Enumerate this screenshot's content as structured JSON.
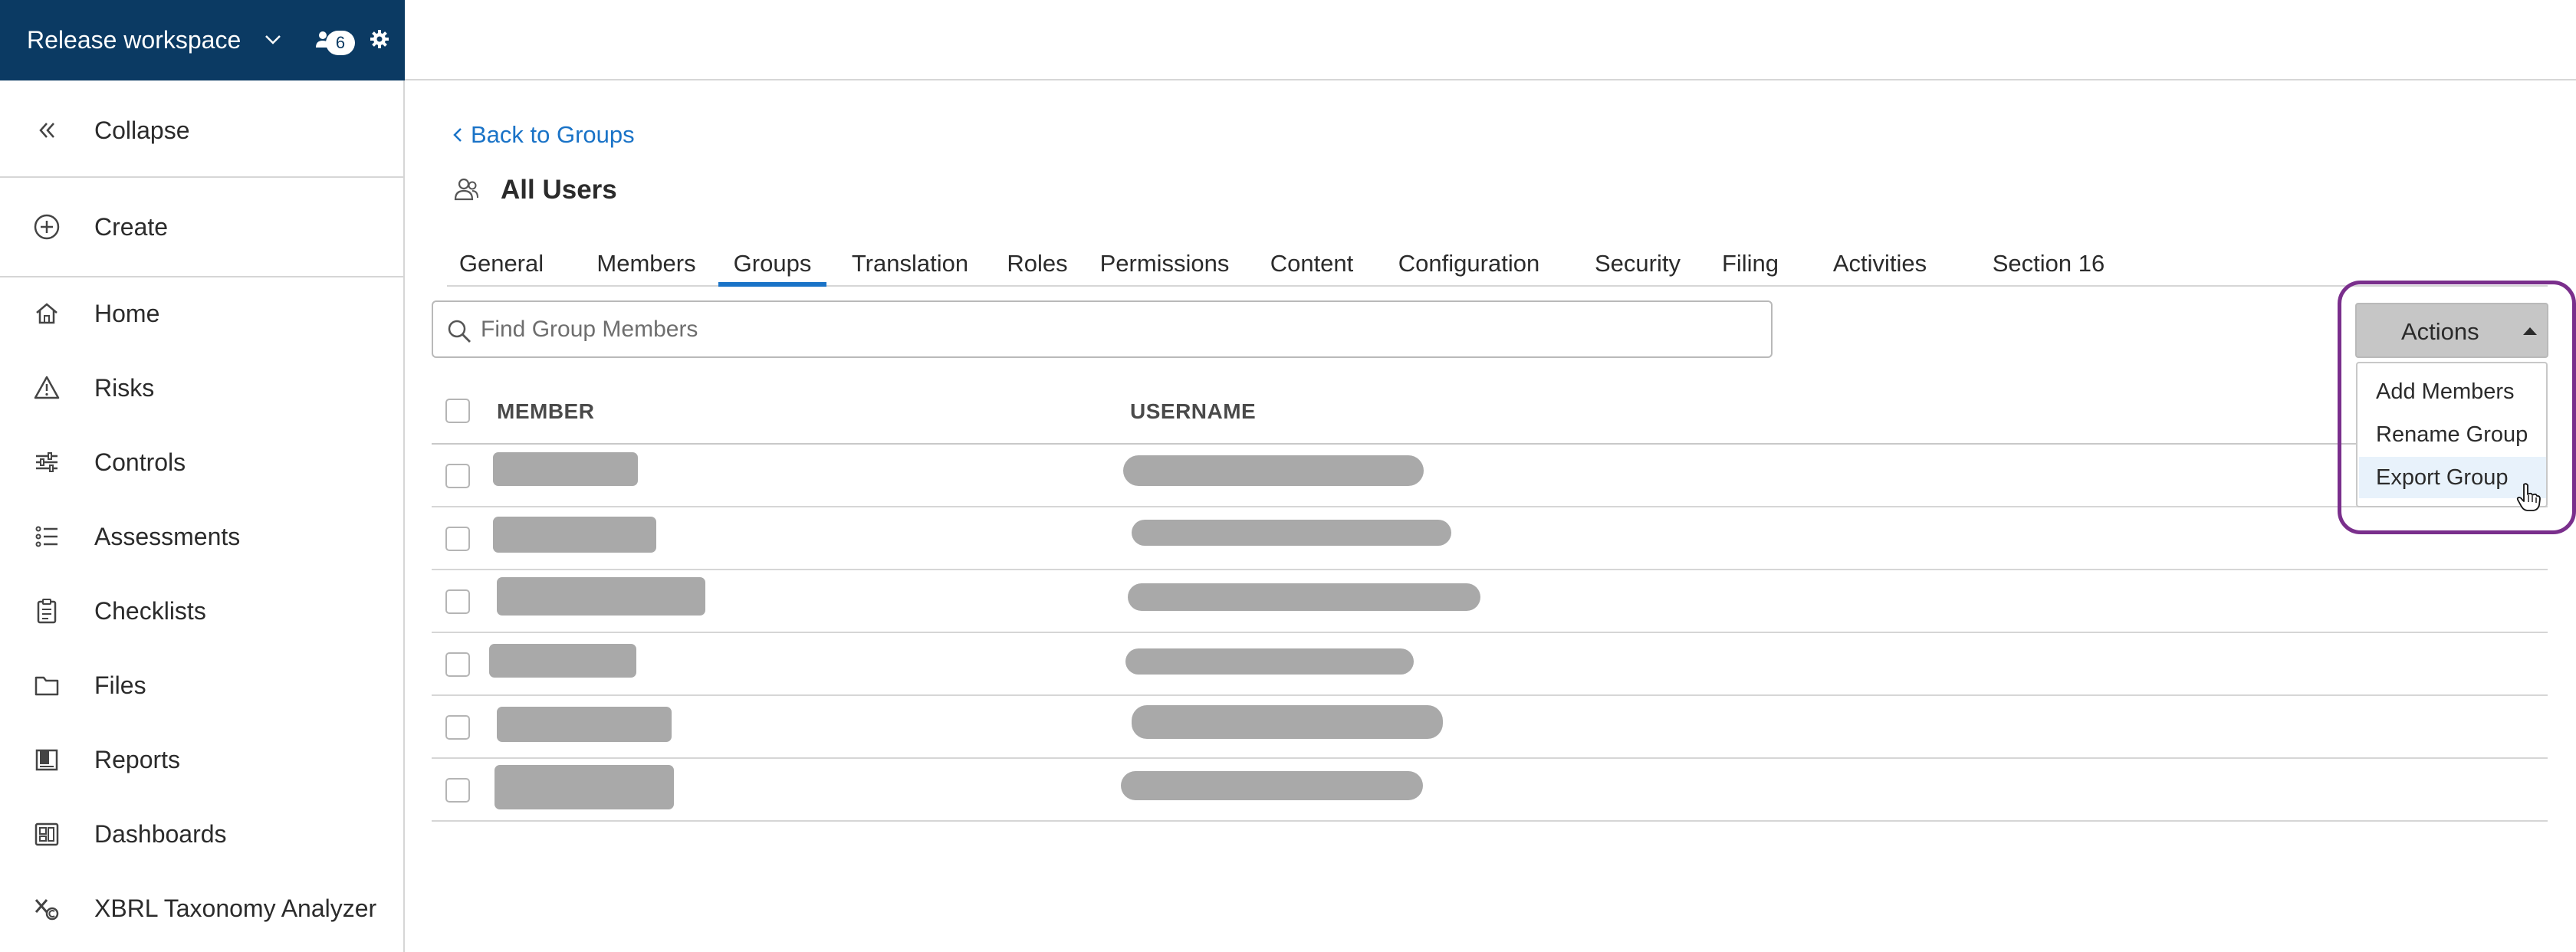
{
  "workspace": {
    "title": "Release workspace",
    "notification_count": "6"
  },
  "sidebar": {
    "collapse_label": "Collapse",
    "create_label": "Create",
    "items": [
      {
        "label": "Home",
        "icon": "home-icon"
      },
      {
        "label": "Risks",
        "icon": "warning-icon"
      },
      {
        "label": "Controls",
        "icon": "sliders-icon"
      },
      {
        "label": "Assessments",
        "icon": "list-icon"
      },
      {
        "label": "Checklists",
        "icon": "clipboard-icon"
      },
      {
        "label": "Files",
        "icon": "folder-icon"
      },
      {
        "label": "Reports",
        "icon": "report-icon"
      },
      {
        "label": "Dashboards",
        "icon": "dashboard-icon"
      },
      {
        "label": "XBRL Taxonomy Analyzer",
        "icon": "xbrl-icon"
      }
    ]
  },
  "main": {
    "back_label": "Back to Groups",
    "title": "All Users",
    "tabs": [
      {
        "label": "General"
      },
      {
        "label": "Members"
      },
      {
        "label": "Groups"
      },
      {
        "label": "Translation"
      },
      {
        "label": "Roles"
      },
      {
        "label": "Permissions"
      },
      {
        "label": "Content"
      },
      {
        "label": "Configuration"
      },
      {
        "label": "Security"
      },
      {
        "label": "Filing"
      },
      {
        "label": "Activities"
      },
      {
        "label": "Section 16"
      }
    ],
    "active_tab": "Groups",
    "search": {
      "placeholder": "Find Group Members",
      "value": ""
    },
    "table": {
      "columns": [
        "MEMBER",
        "USERNAME"
      ],
      "row_count": 6
    }
  },
  "actions": {
    "label": "Actions",
    "items": [
      "Add Members",
      "Rename Group",
      "Export Group"
    ],
    "hovered_item": "Export Group"
  },
  "colors": {
    "header_bg": "#0b3a63",
    "link": "#1a73c7",
    "highlight_outline": "#7a2f8c",
    "redaction": "#a9a9a9"
  }
}
